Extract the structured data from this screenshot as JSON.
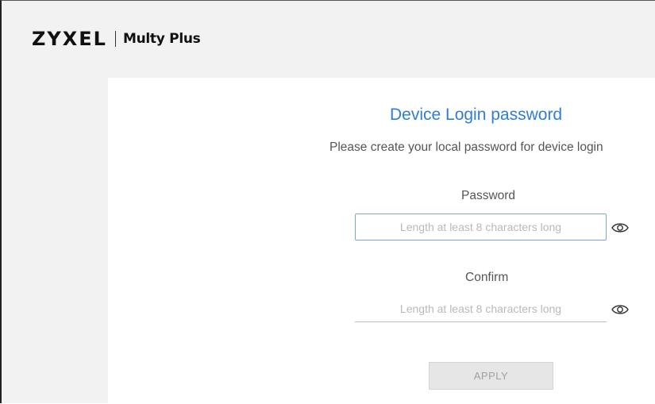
{
  "header": {
    "brand": "ZYXEL",
    "product": "Multy Plus"
  },
  "login": {
    "title": "Device Login password",
    "subtitle": "Please create your local password for device login",
    "password": {
      "label": "Password",
      "placeholder": "Length at least 8 characters long",
      "value": "",
      "icon": "eye-icon"
    },
    "confirm": {
      "label": "Confirm",
      "placeholder": "Length at least 8 characters long",
      "value": "",
      "icon": "eye-icon"
    },
    "apply_label": "APPLY"
  },
  "colors": {
    "title": "#2e7ed6",
    "focus_border": "#7ea5e0",
    "button_bg": "#e6e6e6",
    "button_text": "#a0a0a0",
    "header_bg": "#f2f2f2"
  }
}
